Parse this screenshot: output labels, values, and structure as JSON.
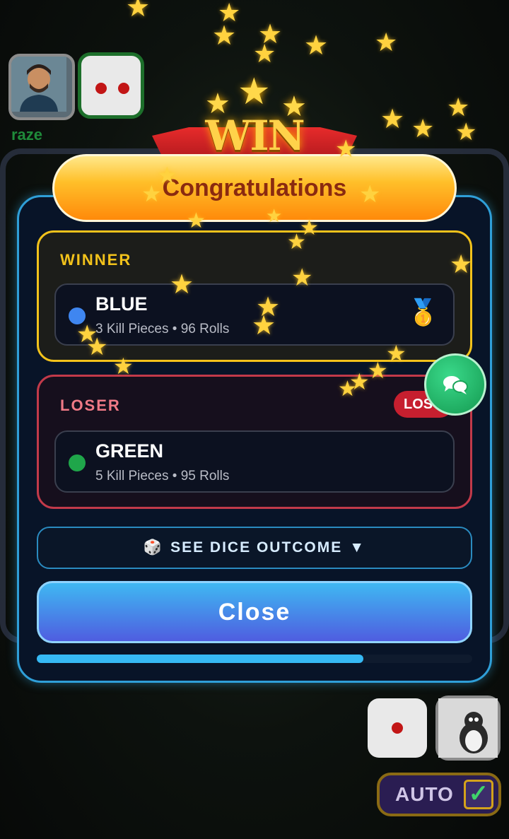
{
  "players": {
    "top_left": {
      "name": "raze"
    },
    "bottom_right": {
      "auto_label": "AUTO",
      "auto_checked": true
    }
  },
  "banner": {
    "win_text": "WIN",
    "congrats_text": "Congratulations"
  },
  "winner": {
    "section_label": "WINNER",
    "color_name": "BLUE",
    "stats": "3 Kill Pieces • 96 Rolls",
    "dot_color": "#3f86f0",
    "medal_icon": "🥇"
  },
  "loser": {
    "section_label": "LOSER",
    "badge_label": "LOST",
    "color_name": "GREEN",
    "stats": "5 Kill Pieces • 95 Rolls",
    "dot_color": "#1fa64a"
  },
  "dice_outcome": {
    "icon": "🎲",
    "label": "SEE DICE OUTCOME",
    "arrow": "▼"
  },
  "close_button": {
    "label": "Close"
  },
  "progress": {
    "fraction": 0.75
  },
  "colors": {
    "accent": "#2f9fd8",
    "winner_border": "#f2c21b",
    "loser_border": "#c23a4a"
  }
}
